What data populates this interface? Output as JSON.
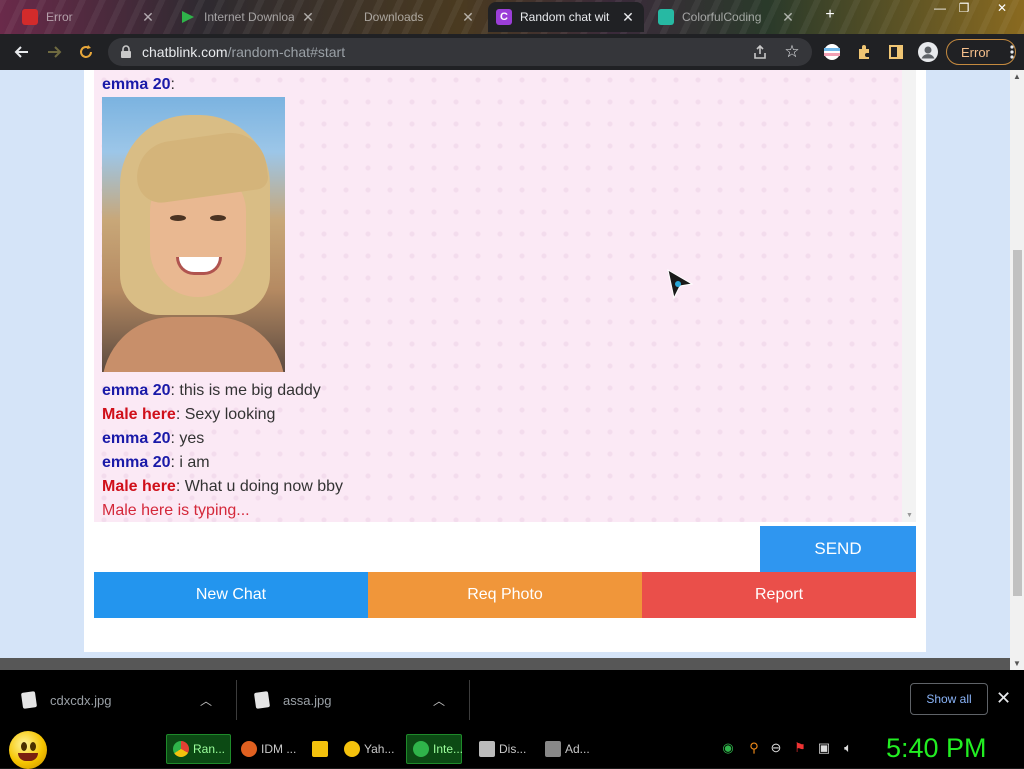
{
  "browser": {
    "tabs": [
      {
        "label": "Error",
        "favicon_color": "#d22b2b",
        "active": false
      },
      {
        "label": "Internet Downloa",
        "favicon_color": "#2fb34a",
        "active": false
      },
      {
        "label": "Downloads",
        "favicon_color": "#ccc",
        "active": false
      },
      {
        "label": "Random chat wit",
        "favicon_color": "#9b3ed8",
        "favicon_text": "C",
        "active": true
      },
      {
        "label": "ColorfulCoding",
        "favicon_color": "#27b9a3",
        "active": false
      }
    ],
    "url_host": "chatblink.com",
    "url_path": "/random-chat#start",
    "error_label": "Error"
  },
  "chat": {
    "messages": [
      {
        "nick": "emma 20",
        "gender": "f",
        "text": ""
      },
      {
        "nick": "emma 20",
        "gender": "f",
        "text": ": this is me big daddy"
      },
      {
        "nick": "Male here",
        "gender": "m",
        "text": ": Sexy looking"
      },
      {
        "nick": "emma 20",
        "gender": "f",
        "text": ": yes"
      },
      {
        "nick": "emma 20",
        "gender": "f",
        "text": ": i am"
      },
      {
        "nick": "Male here",
        "gender": "m",
        "text": ": What u doing now bby"
      }
    ],
    "photo_sep": ":",
    "typing": "Male here is typing...",
    "input_placeholder": "",
    "send_label": "SEND"
  },
  "actions": {
    "new_chat": "New Chat",
    "req_photo": "Req Photo",
    "report": "Report"
  },
  "downloads": {
    "items": [
      {
        "name": "cdxcdx.jpg"
      },
      {
        "name": "assa.jpg"
      }
    ],
    "show_all": "Show all"
  },
  "taskbar": {
    "apps": [
      {
        "label": "Ran...",
        "icon_color": "#e34133",
        "active": true
      },
      {
        "label": "IDM ...",
        "icon_color": "#e06020",
        "active": false
      },
      {
        "label": "",
        "icon_color": "#f4c20d",
        "active": false
      },
      {
        "label": "Yah...",
        "icon_color": "#f4c20d",
        "active": false
      },
      {
        "label": "Inte...",
        "icon_color": "#2fb34a",
        "active": true
      },
      {
        "label": "Dis...",
        "icon_color": "#bbbbbb",
        "active": false
      },
      {
        "label": "Ad...",
        "icon_color": "#888888",
        "active": false
      }
    ],
    "clock": "5:40 PM"
  },
  "colors": {
    "female_nick": "#1a1aa8",
    "male_nick": "#d0101a",
    "send": "#2f96f0",
    "new_chat": "#2395ee",
    "req_photo": "#f0963a",
    "report": "#ea4f4a"
  }
}
